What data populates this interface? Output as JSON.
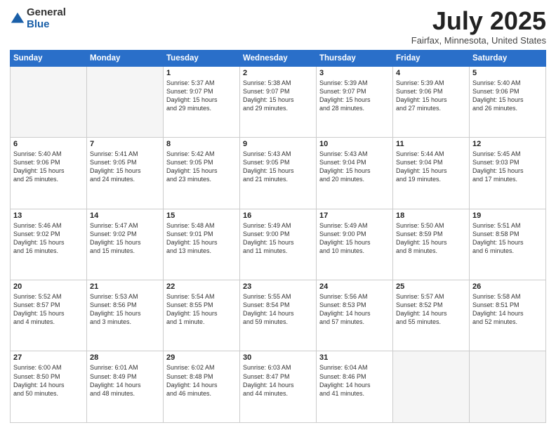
{
  "logo": {
    "general": "General",
    "blue": "Blue"
  },
  "title": {
    "month": "July 2025",
    "location": "Fairfax, Minnesota, United States"
  },
  "days": [
    "Sunday",
    "Monday",
    "Tuesday",
    "Wednesday",
    "Thursday",
    "Friday",
    "Saturday"
  ],
  "weeks": [
    [
      {
        "day": "",
        "content": ""
      },
      {
        "day": "",
        "content": ""
      },
      {
        "day": "1",
        "content": "Sunrise: 5:37 AM\nSunset: 9:07 PM\nDaylight: 15 hours\nand 29 minutes."
      },
      {
        "day": "2",
        "content": "Sunrise: 5:38 AM\nSunset: 9:07 PM\nDaylight: 15 hours\nand 29 minutes."
      },
      {
        "day": "3",
        "content": "Sunrise: 5:39 AM\nSunset: 9:07 PM\nDaylight: 15 hours\nand 28 minutes."
      },
      {
        "day": "4",
        "content": "Sunrise: 5:39 AM\nSunset: 9:06 PM\nDaylight: 15 hours\nand 27 minutes."
      },
      {
        "day": "5",
        "content": "Sunrise: 5:40 AM\nSunset: 9:06 PM\nDaylight: 15 hours\nand 26 minutes."
      }
    ],
    [
      {
        "day": "6",
        "content": "Sunrise: 5:40 AM\nSunset: 9:06 PM\nDaylight: 15 hours\nand 25 minutes."
      },
      {
        "day": "7",
        "content": "Sunrise: 5:41 AM\nSunset: 9:05 PM\nDaylight: 15 hours\nand 24 minutes."
      },
      {
        "day": "8",
        "content": "Sunrise: 5:42 AM\nSunset: 9:05 PM\nDaylight: 15 hours\nand 23 minutes."
      },
      {
        "day": "9",
        "content": "Sunrise: 5:43 AM\nSunset: 9:05 PM\nDaylight: 15 hours\nand 21 minutes."
      },
      {
        "day": "10",
        "content": "Sunrise: 5:43 AM\nSunset: 9:04 PM\nDaylight: 15 hours\nand 20 minutes."
      },
      {
        "day": "11",
        "content": "Sunrise: 5:44 AM\nSunset: 9:04 PM\nDaylight: 15 hours\nand 19 minutes."
      },
      {
        "day": "12",
        "content": "Sunrise: 5:45 AM\nSunset: 9:03 PM\nDaylight: 15 hours\nand 17 minutes."
      }
    ],
    [
      {
        "day": "13",
        "content": "Sunrise: 5:46 AM\nSunset: 9:02 PM\nDaylight: 15 hours\nand 16 minutes."
      },
      {
        "day": "14",
        "content": "Sunrise: 5:47 AM\nSunset: 9:02 PM\nDaylight: 15 hours\nand 15 minutes."
      },
      {
        "day": "15",
        "content": "Sunrise: 5:48 AM\nSunset: 9:01 PM\nDaylight: 15 hours\nand 13 minutes."
      },
      {
        "day": "16",
        "content": "Sunrise: 5:49 AM\nSunset: 9:00 PM\nDaylight: 15 hours\nand 11 minutes."
      },
      {
        "day": "17",
        "content": "Sunrise: 5:49 AM\nSunset: 9:00 PM\nDaylight: 15 hours\nand 10 minutes."
      },
      {
        "day": "18",
        "content": "Sunrise: 5:50 AM\nSunset: 8:59 PM\nDaylight: 15 hours\nand 8 minutes."
      },
      {
        "day": "19",
        "content": "Sunrise: 5:51 AM\nSunset: 8:58 PM\nDaylight: 15 hours\nand 6 minutes."
      }
    ],
    [
      {
        "day": "20",
        "content": "Sunrise: 5:52 AM\nSunset: 8:57 PM\nDaylight: 15 hours\nand 4 minutes."
      },
      {
        "day": "21",
        "content": "Sunrise: 5:53 AM\nSunset: 8:56 PM\nDaylight: 15 hours\nand 3 minutes."
      },
      {
        "day": "22",
        "content": "Sunrise: 5:54 AM\nSunset: 8:55 PM\nDaylight: 15 hours\nand 1 minute."
      },
      {
        "day": "23",
        "content": "Sunrise: 5:55 AM\nSunset: 8:54 PM\nDaylight: 14 hours\nand 59 minutes."
      },
      {
        "day": "24",
        "content": "Sunrise: 5:56 AM\nSunset: 8:53 PM\nDaylight: 14 hours\nand 57 minutes."
      },
      {
        "day": "25",
        "content": "Sunrise: 5:57 AM\nSunset: 8:52 PM\nDaylight: 14 hours\nand 55 minutes."
      },
      {
        "day": "26",
        "content": "Sunrise: 5:58 AM\nSunset: 8:51 PM\nDaylight: 14 hours\nand 52 minutes."
      }
    ],
    [
      {
        "day": "27",
        "content": "Sunrise: 6:00 AM\nSunset: 8:50 PM\nDaylight: 14 hours\nand 50 minutes."
      },
      {
        "day": "28",
        "content": "Sunrise: 6:01 AM\nSunset: 8:49 PM\nDaylight: 14 hours\nand 48 minutes."
      },
      {
        "day": "29",
        "content": "Sunrise: 6:02 AM\nSunset: 8:48 PM\nDaylight: 14 hours\nand 46 minutes."
      },
      {
        "day": "30",
        "content": "Sunrise: 6:03 AM\nSunset: 8:47 PM\nDaylight: 14 hours\nand 44 minutes."
      },
      {
        "day": "31",
        "content": "Sunrise: 6:04 AM\nSunset: 8:46 PM\nDaylight: 14 hours\nand 41 minutes."
      },
      {
        "day": "",
        "content": ""
      },
      {
        "day": "",
        "content": ""
      }
    ]
  ]
}
